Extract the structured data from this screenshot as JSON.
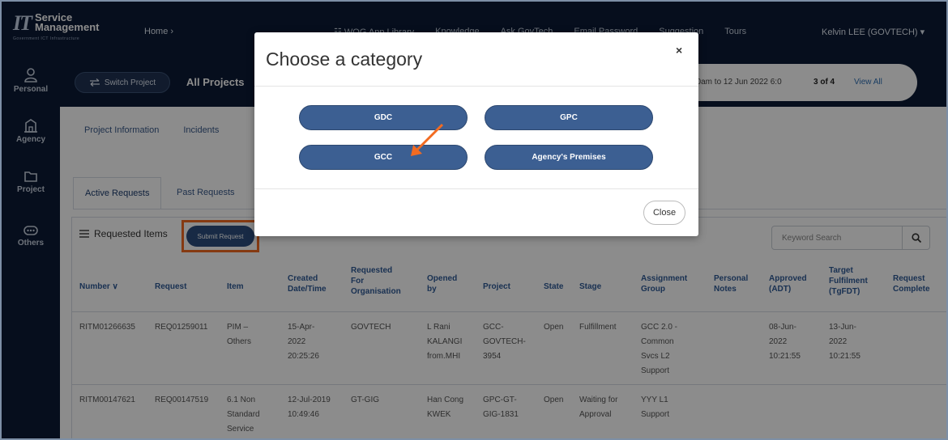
{
  "header": {
    "logo_mark": "IT",
    "logo_line1": "Service",
    "logo_line2": "Management",
    "logo_sub": "Government ICT Infrastructure",
    "home": "Home ›",
    "nav": [
      "☷  WOG App Library",
      "Knowledge",
      "Ask GovTech",
      "Email Password",
      "Suggestion",
      "Tours"
    ],
    "user": "Kelvin LEE (GOVTECH)  ▾"
  },
  "sidebar": {
    "items": [
      {
        "label": "Personal",
        "icon": "person-icon"
      },
      {
        "label": "Agency",
        "icon": "building-icon"
      },
      {
        "label": "Project",
        "icon": "folder-icon"
      },
      {
        "label": "Others",
        "icon": "more-icon"
      }
    ]
  },
  "project_bar": {
    "switch_label": "Switch Project",
    "title": "All Projects",
    "range": "00am to 12 Jun 2022 6:0",
    "count": "3 of 4",
    "view_all": "View All"
  },
  "tabs_top": [
    "Project Information",
    "Incidents"
  ],
  "tabs_requests": {
    "active": "Active Requests",
    "past": "Past Requests"
  },
  "panel": {
    "title": "Requested Items",
    "submit_label": "Submit Request",
    "search_placeholder": "Keyword Search"
  },
  "table": {
    "headers": [
      "Number  ∨",
      "Request",
      "Item",
      "Created\nDate/Time",
      "Requested\nFor\nOrganisation",
      "Opened\nby",
      "Project",
      "State",
      "Stage",
      "Assignment\nGroup",
      "Personal\nNotes",
      "Approved\n(ADT)",
      "Target\nFulfilment\n(TgFDT)",
      "Request\nComplete"
    ],
    "rows": [
      [
        "RITM01266635",
        "REQ01259011",
        "PIM –\nOthers",
        "15-Apr-\n2022\n20:25:26",
        "GOVTECH",
        "L Rani\nKALANGI\nfrom.MHI",
        "GCC-\nGOVTECH-\n3954",
        "Open",
        "Fulfillment",
        "GCC 2.0 -\nCommon\nSvcs L2\nSupport",
        "",
        "08-Jun-\n2022\n10:21:55",
        "13-Jun-\n2022\n10:21:55",
        ""
      ],
      [
        "RITM00147621",
        "REQ00147519",
        "6.1 Non\nStandard\nService",
        "12-Jul-2019\n10:49:46",
        "GT-GIG",
        "Han Cong\nKWEK",
        "GPC-GT-\nGIG-1831",
        "Open",
        "Waiting for\nApproval",
        "YYY L1\nSupport",
        "",
        "",
        "",
        ""
      ]
    ]
  },
  "modal": {
    "title": "Choose a category",
    "close_x": "×",
    "categories": [
      "GDC",
      "GPC",
      "GCC",
      "Agency's Premises"
    ],
    "close_label": "Close"
  },
  "colors": {
    "nav_bg": "#0c1a35",
    "button_blue": "#3c5f92",
    "highlight_orange": "#f26b21",
    "link_blue": "#2f5a96"
  }
}
